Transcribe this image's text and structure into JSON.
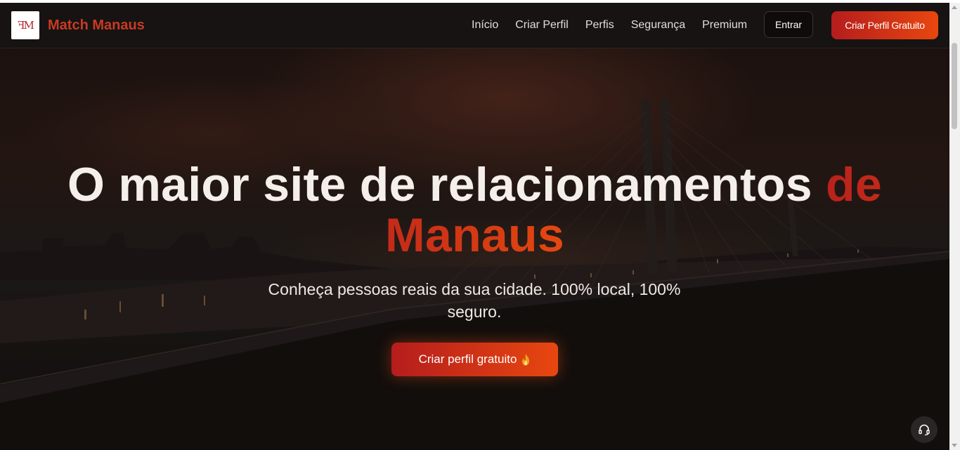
{
  "header": {
    "logo_text": "ꟻM",
    "brand": "Match Manaus",
    "nav": [
      {
        "label": "Início"
      },
      {
        "label": "Criar Perfil"
      },
      {
        "label": "Perfis"
      },
      {
        "label": "Segurança"
      },
      {
        "label": "Premium"
      }
    ],
    "login_label": "Entrar",
    "signup_label": "Criar Perfil Gratuito"
  },
  "hero": {
    "headline_main": "O maior site de relacionamentos ",
    "headline_accent": "de Manaus",
    "subtitle": "Conheça pessoas reais da sua cidade. 100% local, 100% seguro.",
    "cta_label": "Criar perfil gratuito",
    "cta_icon": "flame-icon",
    "background_icon": "bridge-night-photo"
  },
  "support": {
    "icon": "headset-icon"
  },
  "colors": {
    "accent_start": "#b51d1d",
    "accent_end": "#e8470f",
    "brand": "#c93a24",
    "header_bg": "#161312"
  }
}
